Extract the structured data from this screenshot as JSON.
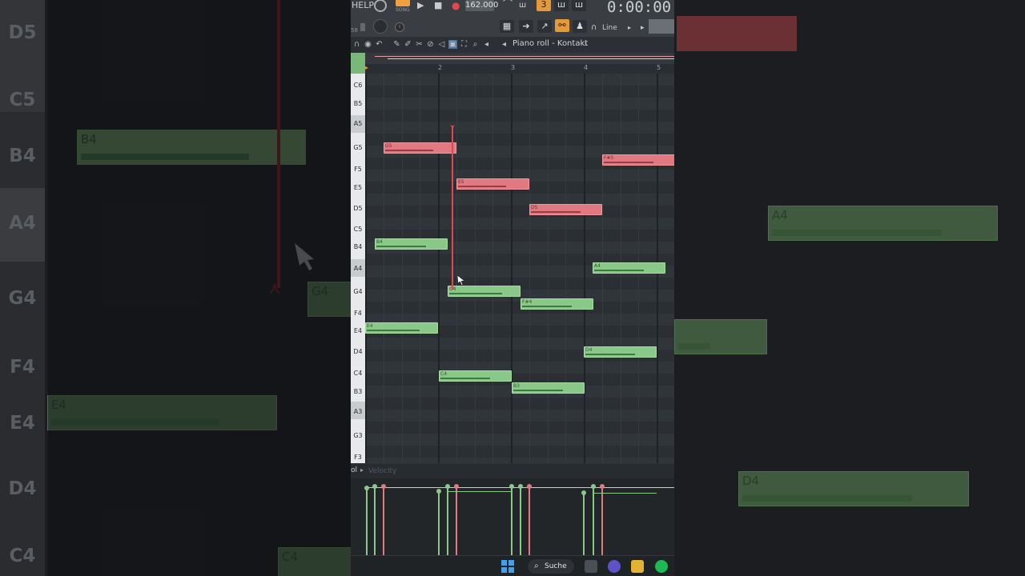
{
  "background_zoom": {
    "keys": [
      "D5",
      "C5",
      "B4",
      "A4",
      "G4",
      "F4",
      "E4",
      "D4",
      "C4"
    ],
    "notes": [
      "B4",
      "A4",
      "G4",
      "E4",
      "D4",
      "C4"
    ]
  },
  "toolbar": {
    "help_label": "HELP",
    "tempo": "162.000",
    "timer": "0:00:00",
    "snap_mode": "Line",
    "mode_label": "SONG",
    "pattern_label": "3"
  },
  "piano_roll": {
    "title": "Piano roll - Kontakt",
    "bar_numbers": [
      "2",
      "3",
      "4",
      "5"
    ],
    "keys": [
      "C6",
      "B5",
      "A5",
      "G5",
      "F5",
      "E5",
      "D5",
      "C5",
      "B4",
      "A4",
      "G4",
      "F4",
      "E4",
      "D4",
      "C4",
      "B3",
      "A3",
      "G3",
      "F3"
    ],
    "notes": [
      {
        "label": "G5",
        "color": "red"
      },
      {
        "label": "E5",
        "color": "red"
      },
      {
        "label": "D5",
        "color": "red"
      },
      {
        "label": "F#5",
        "color": "red"
      },
      {
        "label": "B4",
        "color": "green"
      },
      {
        "label": "A4",
        "color": "green"
      },
      {
        "label": "G4",
        "color": "green"
      },
      {
        "label": "F#4",
        "color": "green"
      },
      {
        "label": "E4",
        "color": "green"
      },
      {
        "label": "D4",
        "color": "green"
      },
      {
        "label": "C4",
        "color": "green"
      },
      {
        "label": "B3",
        "color": "green"
      }
    ]
  },
  "event_editor": {
    "target_prefix": "ol",
    "target_label": "Velocity"
  },
  "taskbar": {
    "search_label": "Suche"
  },
  "colors": {
    "green_note": "#8ac88a",
    "red_note": "#e07a80",
    "playhead": "#e0484f"
  }
}
